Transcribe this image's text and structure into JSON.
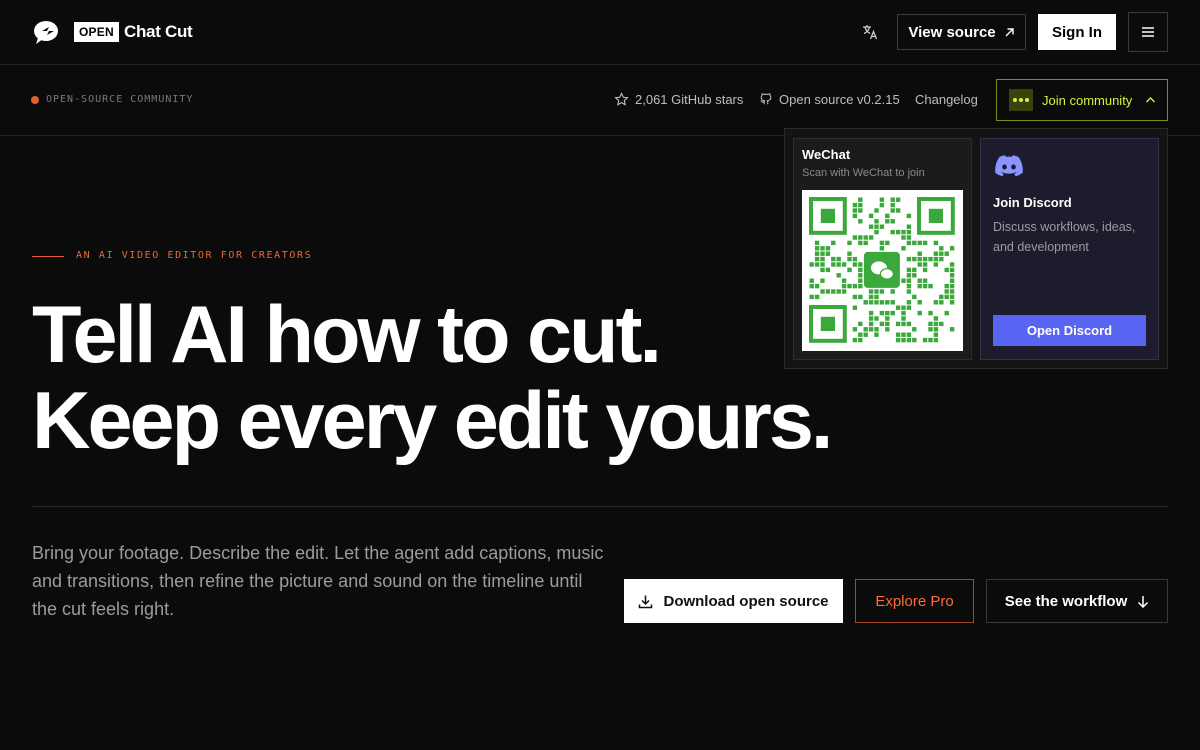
{
  "nav": {
    "brand_badge": "OPEN",
    "brand_name": "Chat Cut",
    "view_source": "View source",
    "sign_in": "Sign In"
  },
  "subbar": {
    "community_label": "OPEN-SOURCE COMMUNITY",
    "github_stars": "2,061 GitHub stars",
    "version": "Open source v0.2.15",
    "changelog": "Changelog",
    "join": "Join community"
  },
  "dropdown": {
    "wechat_title": "WeChat",
    "wechat_sub": "Scan with WeChat to join",
    "discord_title": "Join Discord",
    "discord_desc": "Discuss workflows, ideas, and development",
    "discord_button": "Open Discord"
  },
  "hero": {
    "eyebrow": "AN AI VIDEO EDITOR FOR CREATORS",
    "headline_1": "Tell AI how to cut.",
    "headline_2": "Keep every edit yours.",
    "description": "Bring your footage. Describe the edit. Let the agent add captions, music and transitions, then refine the picture and sound on the timeline until the cut feels right.",
    "cta_download": "Download open source",
    "cta_pro": "Explore Pro",
    "cta_workflow": "See the workflow"
  },
  "colors": {
    "accent_orange": "#e86a35",
    "accent_lime": "#d6f23a",
    "discord_blue": "#5865f2",
    "wechat_green": "#3aa83a"
  },
  "icons": [
    "logo-icon",
    "translate-icon",
    "external-arrow-icon",
    "menu-icon",
    "star-icon",
    "github-icon",
    "chevron-up-icon",
    "wechat-qr-icon",
    "discord-icon",
    "download-icon",
    "arrow-down-icon"
  ]
}
